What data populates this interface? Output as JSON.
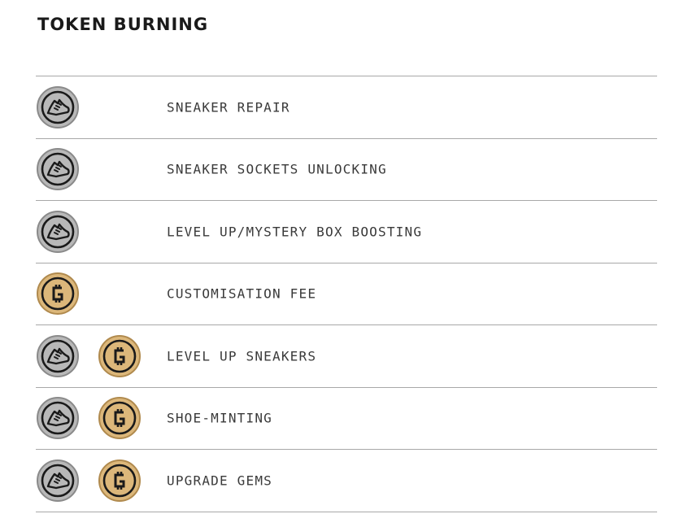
{
  "title": "TOKEN BURNING",
  "colors": {
    "gst_coin_fill": "#b8b8b8",
    "gst_coin_ring": "#8a8a8a",
    "gmt_coin_fill": "#dcb77a",
    "gmt_coin_ring": "#b08a4e",
    "icon_stroke": "#1a1a1a",
    "divider": "#a8a8a8",
    "label_text": "#3a3a3a",
    "title_text": "#1a1a1a"
  },
  "rows": [
    {
      "label": "SNEAKER REPAIR",
      "tokens": [
        "gst-sneaker-icon"
      ]
    },
    {
      "label": "SNEAKER SOCKETS UNLOCKING",
      "tokens": [
        "gst-sneaker-icon"
      ]
    },
    {
      "label": "LEVEL UP/MYSTERY BOX BOOSTING",
      "tokens": [
        "gst-sneaker-icon"
      ]
    },
    {
      "label": "CUSTOMISATION FEE",
      "tokens": [
        "gmt-coin-icon"
      ]
    },
    {
      "label": "LEVEL UP SNEAKERS",
      "tokens": [
        "gst-sneaker-icon",
        "gmt-coin-icon"
      ]
    },
    {
      "label": "SHOE-MINTING",
      "tokens": [
        "gst-sneaker-icon",
        "gmt-coin-icon"
      ]
    },
    {
      "label": "UPGRADE GEMS",
      "tokens": [
        "gst-sneaker-icon",
        "gmt-coin-icon"
      ]
    }
  ]
}
